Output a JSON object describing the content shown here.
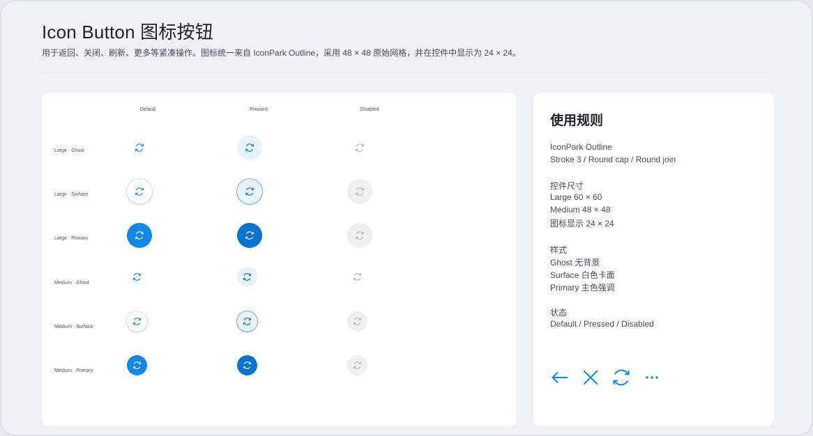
{
  "header": {
    "title": "Icon Button 图标按钮",
    "subtitle": "用于返回、关闭、刷新、更多等紧凑操作。图标统一来自 IconPark Outline，采用 48 × 48 原始网格，并在控件中显示为 24 × 24。"
  },
  "matrix": {
    "columns": [
      "Default",
      "Pressed",
      "Disabled"
    ],
    "rows": [
      "Large · Ghost",
      "Large · Surface",
      "Large · Primary",
      "Medium · Ghost",
      "Medium · Surface",
      "Medium · Primary"
    ],
    "button_icon": "refresh-icon"
  },
  "rules": {
    "title": "使用规则",
    "groups": [
      {
        "lines": [
          "IconPark Outline",
          "Stroke 3 / Round cap / Round join"
        ]
      },
      {
        "lines": [
          "控件尺寸",
          "Large  60 × 60",
          "Medium  48 × 48",
          "图标显示  24 × 24"
        ]
      },
      {
        "lines": [
          "样式",
          "Ghost  无背景",
          "Surface  白色卡面",
          "Primary  主色强调"
        ]
      },
      {
        "lines": [
          "状态",
          "Default / Pressed / Disabled"
        ]
      }
    ],
    "demo_icons": [
      "arrow-left-icon",
      "close-icon",
      "refresh-icon",
      "more-icon"
    ]
  },
  "colors": {
    "accent": "#1187e8",
    "accent_pressed": "#0a72cf",
    "pressed_bg": "#e8f2fc",
    "disabled_bg": "#efefef",
    "disabled_icon": "#b5b5b5",
    "page_bg": "#eef1f6"
  }
}
